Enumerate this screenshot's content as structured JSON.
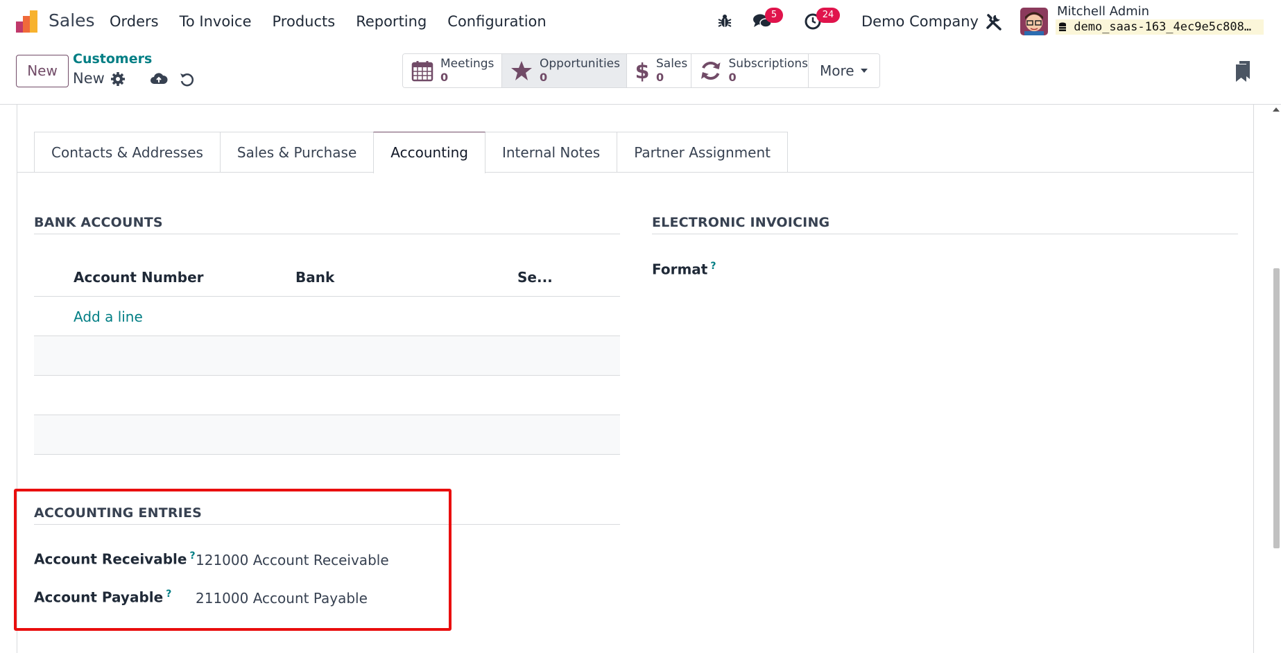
{
  "navbar": {
    "app_name": "Sales",
    "menu": [
      "Orders",
      "To Invoice",
      "Products",
      "Reporting",
      "Configuration"
    ],
    "messages_count": "5",
    "activities_count": "24",
    "company": "Demo Company",
    "user_name": "Mitchell Admin",
    "database": "demo_saas-163_4ec9e5c808…"
  },
  "control": {
    "new_label": "New",
    "breadcrumb_parent": "Customers",
    "breadcrumb_current": "New",
    "smart_buttons": [
      {
        "label": "Meetings",
        "value": "0",
        "icon": "calendar-icon"
      },
      {
        "label": "Opportunities",
        "value": "0",
        "icon": "star-icon"
      },
      {
        "label": "Sales",
        "value": "0",
        "icon": "dollar-icon"
      },
      {
        "label": "Subscriptions",
        "value": "0",
        "icon": "refresh-icon"
      }
    ],
    "more_label": "More"
  },
  "tabs": [
    "Contacts & Addresses",
    "Sales & Purchase",
    "Accounting",
    "Internal Notes",
    "Partner Assignment"
  ],
  "active_tab": "Accounting",
  "bank_accounts": {
    "title": "BANK ACCOUNTS",
    "columns": [
      "Account Number",
      "Bank",
      "Se..."
    ],
    "add_line": "Add a line"
  },
  "electronic_invoicing": {
    "title": "ELECTRONIC INVOICING",
    "format_label": "Format",
    "help_mark": "?"
  },
  "accounting_entries": {
    "title": "ACCOUNTING ENTRIES",
    "receivable_label": "Account Receivable",
    "receivable_value": "121000 Account Receivable",
    "payable_label": "Account Payable",
    "payable_value": "211000 Account Payable",
    "help_mark": "?"
  },
  "colors": {
    "brand": "#714b67",
    "link": "#017e84",
    "badge": "#e0144c",
    "highlight": "#e90e0e"
  }
}
